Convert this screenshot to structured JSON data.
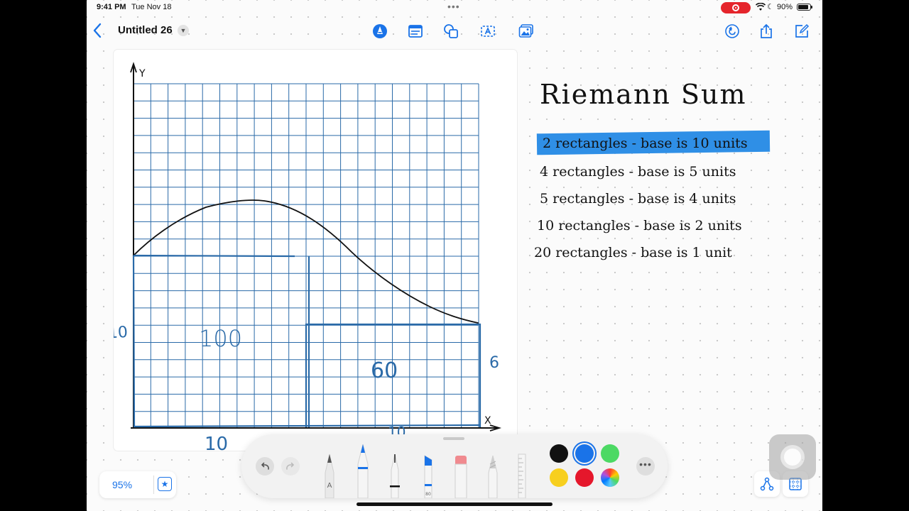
{
  "status_bar": {
    "time": "9:41 PM",
    "date": "Tue Nov 18",
    "multitask_dots": "•••",
    "battery": "90%",
    "battery_level": 0.9,
    "recording_color": "#e5252c"
  },
  "nav": {
    "back_icon": "chevron-left-icon",
    "title": "Untitled 26",
    "center_tools": [
      "pen-tip-icon",
      "text-box-icon",
      "shapes-icon",
      "text-frame-icon",
      "insert-image-icon"
    ],
    "right_tools": [
      "undo-history-icon",
      "share-icon",
      "compose-icon"
    ],
    "accent_color": "#1a73e8"
  },
  "drawing": {
    "axis_y": "Y",
    "axis_x": "X",
    "rect1_height_label": "10",
    "rect1_area": "100",
    "rect2_area": "60",
    "rect2_height_label": "6",
    "rect1_base_label": "10",
    "rect2_base_label": "10",
    "grid_color": "#2a6aa8",
    "rect_color": "#2a6aa8",
    "curve_color": "#111111"
  },
  "notes": {
    "title": "Riemann Sum",
    "lines": [
      "2 rectangles - base is 10 units",
      "4 rectangles - base is 5 units",
      "5 rectangles - base is 4 units",
      "10 rectangles - base is 2 units",
      "20 rectangles - base is 1 unit"
    ],
    "highlight_color": "#2f8fe6"
  },
  "toolbar": {
    "undo_icon": "undo-icon",
    "redo_icon": "redo-icon",
    "tools": [
      "pencil-tool",
      "pen-tool",
      "fineliner-tool",
      "highlighter-tool",
      "eraser-tool",
      "crayon-tool",
      "ruler-tool"
    ],
    "pencil_letter": "A",
    "highlighter_size": "80",
    "colors": [
      "#111111",
      "#1a73e8",
      "#4cd964",
      "#f7cf1e",
      "#e5172b",
      "color-wheel"
    ],
    "selected_color": "#1a73e8",
    "more_icon": "more-icon"
  },
  "zoom": {
    "level": "95%",
    "favorite_icon": "star-icon"
  },
  "bottom_right": {
    "left_icon": "connectors-icon",
    "right_icon": "grid-icon"
  }
}
